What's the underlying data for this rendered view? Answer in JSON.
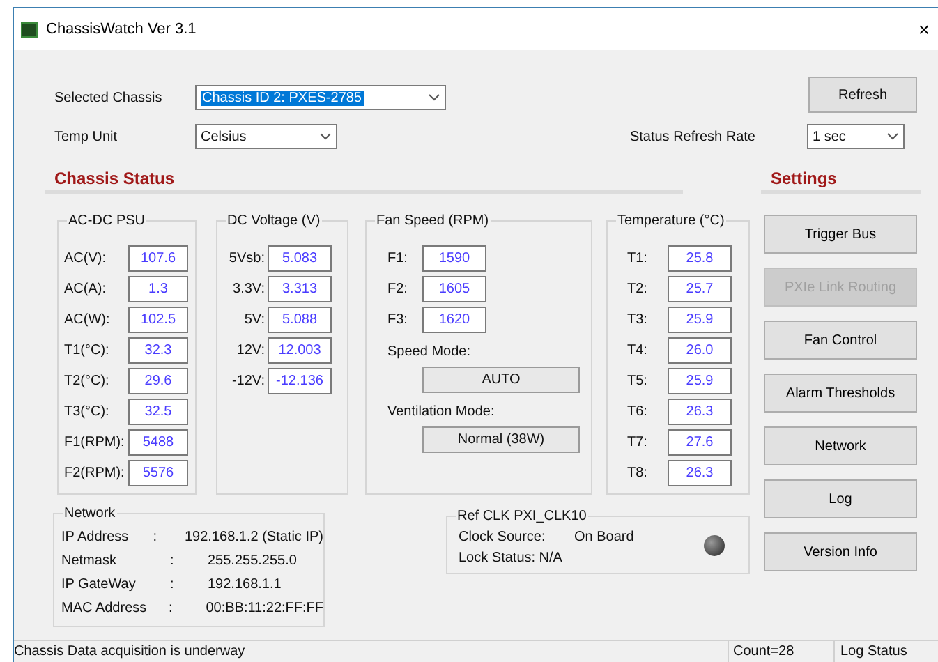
{
  "window": {
    "title": "ChassisWatch Ver 3.1",
    "close": "×"
  },
  "selected_chassis": {
    "label": "Selected Chassis",
    "value": "Chassis ID 2: PXES-2785",
    "highlighted": true
  },
  "temp_unit": {
    "label": "Temp Unit",
    "value": "Celsius"
  },
  "refresh_button": "Refresh",
  "status_refresh_rate": {
    "label": "Status Refresh Rate",
    "value": "1 sec"
  },
  "chassis_status": {
    "title": "Chassis Status"
  },
  "psu": {
    "title": "AC-DC PSU",
    "rows": [
      {
        "label": "AC(V):",
        "value": "107.6"
      },
      {
        "label": "AC(A):",
        "value": "1.3"
      },
      {
        "label": "AC(W):",
        "value": "102.5"
      },
      {
        "label": "T1(°C):",
        "value": "32.3"
      },
      {
        "label": "T2(°C):",
        "value": "29.6"
      },
      {
        "label": "T3(°C):",
        "value": "32.5"
      },
      {
        "label": "F1(RPM):",
        "value": "5488"
      },
      {
        "label": "F2(RPM):",
        "value": "5576"
      }
    ]
  },
  "dc_voltage": {
    "title": "DC Voltage (V)",
    "rows": [
      {
        "label": "5Vsb:",
        "value": "5.083"
      },
      {
        "label": "3.3V:",
        "value": "3.313"
      },
      {
        "label": "5V:",
        "value": "5.088"
      },
      {
        "label": "12V:",
        "value": "12.003"
      },
      {
        "label": "-12V:",
        "value": "-12.136"
      }
    ]
  },
  "fan_speed": {
    "title": "Fan Speed (RPM)",
    "rows": [
      {
        "label": "F1:",
        "value": "1590"
      },
      {
        "label": "F2:",
        "value": "1605"
      },
      {
        "label": "F3:",
        "value": "1620"
      }
    ],
    "speed_mode": {
      "label": "Speed Mode:",
      "value": "AUTO"
    },
    "ventilation_mode": {
      "label": "Ventilation Mode:",
      "value": "Normal (38W)"
    }
  },
  "temperature": {
    "title": "Temperature (°C)",
    "rows": [
      {
        "label": "T1:",
        "value": "25.8"
      },
      {
        "label": "T2:",
        "value": "25.7"
      },
      {
        "label": "T3:",
        "value": "25.9"
      },
      {
        "label": "T4:",
        "value": "26.0"
      },
      {
        "label": "T5:",
        "value": "25.9"
      },
      {
        "label": "T6:",
        "value": "26.3"
      },
      {
        "label": "T7:",
        "value": "27.6"
      },
      {
        "label": "T8:",
        "value": "26.3"
      }
    ]
  },
  "settings": {
    "title": "Settings",
    "buttons": [
      {
        "label": "Trigger Bus",
        "disabled": false
      },
      {
        "label": "PXIe Link Routing",
        "disabled": true
      },
      {
        "label": "Fan Control",
        "disabled": false
      },
      {
        "label": "Alarm Thresholds",
        "disabled": false
      },
      {
        "label": "Network",
        "disabled": false
      },
      {
        "label": "Log",
        "disabled": false
      },
      {
        "label": "Version Info",
        "disabled": false
      }
    ]
  },
  "network": {
    "title": "Network",
    "rows": [
      {
        "label": "IP Address",
        "separator": ":",
        "value": "192.168.1.2 (Static IP)"
      },
      {
        "label": "Netmask",
        "separator": ":",
        "value": "255.255.255.0"
      },
      {
        "label": "IP GateWay",
        "separator": ":",
        "value": "192.168.1.1"
      },
      {
        "label": "MAC Address",
        "separator": ":",
        "value": "00:BB:11:22:FF:FF"
      }
    ]
  },
  "ref_clk": {
    "title": "Ref CLK PXI_CLK10",
    "clock_source_label": "Clock Source:",
    "clock_source_value": "On Board",
    "lock_status": "Lock Status: N/A",
    "locked": false
  },
  "status_bar": {
    "message": "Chassis Data acquisition is underway",
    "count": "Count=28",
    "log_status": "Log Status"
  }
}
